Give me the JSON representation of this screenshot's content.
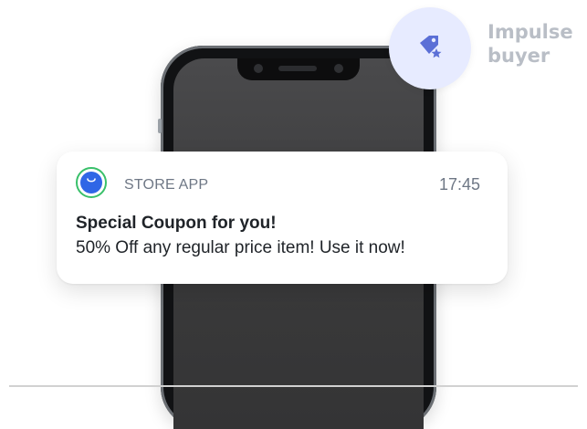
{
  "persona": {
    "icon": "tag-star-icon",
    "label_line1": "Impulse",
    "label_line2": "buyer",
    "color": "#b9bec6",
    "badge_bg": "#e7ebff",
    "icon_color": "#5b6fd6"
  },
  "notification": {
    "app_icon": "shopping-bag-icon",
    "app_name": "STORE APP",
    "time": "17:45",
    "title": "Special Coupon for you!",
    "body": "50% Off any regular price item! Use it now!",
    "accent_ring": "#39c06a",
    "app_icon_color": "#2f66e6"
  },
  "device": {
    "type": "smartphone",
    "screen_color": "#404041"
  }
}
